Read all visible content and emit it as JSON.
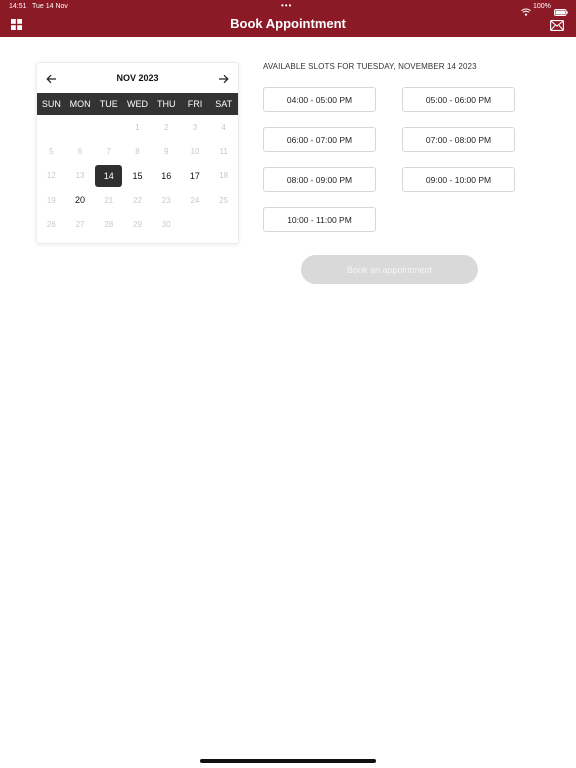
{
  "status_bar": {
    "time": "14:51",
    "date": "Tue 14 Nov",
    "dots": "•••",
    "battery": "100%"
  },
  "header": {
    "title": "Book Appointment",
    "menu_icon": "grid-icon",
    "mail_icon": "mail-icon",
    "background_color": "#8b1a26"
  },
  "calendar": {
    "month_label": "NOV 2023",
    "prev_icon": "arrow-left-icon",
    "next_icon": "arrow-right-icon",
    "weekdays": [
      "SUN",
      "MON",
      "TUE",
      "WED",
      "THU",
      "FRI",
      "SAT"
    ],
    "days": [
      {
        "label": "",
        "state": "blank"
      },
      {
        "label": "",
        "state": "blank"
      },
      {
        "label": "",
        "state": "blank"
      },
      {
        "label": "1",
        "state": "disabled"
      },
      {
        "label": "2",
        "state": "disabled"
      },
      {
        "label": "3",
        "state": "disabled"
      },
      {
        "label": "4",
        "state": "disabled"
      },
      {
        "label": "5",
        "state": "disabled"
      },
      {
        "label": "6",
        "state": "disabled"
      },
      {
        "label": "7",
        "state": "disabled"
      },
      {
        "label": "8",
        "state": "disabled"
      },
      {
        "label": "9",
        "state": "disabled"
      },
      {
        "label": "10",
        "state": "disabled"
      },
      {
        "label": "11",
        "state": "disabled"
      },
      {
        "label": "12",
        "state": "disabled"
      },
      {
        "label": "13",
        "state": "disabled"
      },
      {
        "label": "14",
        "state": "selected"
      },
      {
        "label": "15",
        "state": "active"
      },
      {
        "label": "16",
        "state": "active"
      },
      {
        "label": "17",
        "state": "active"
      },
      {
        "label": "18",
        "state": "disabled"
      },
      {
        "label": "19",
        "state": "disabled"
      },
      {
        "label": "20",
        "state": "active"
      },
      {
        "label": "21",
        "state": "disabled"
      },
      {
        "label": "22",
        "state": "disabled"
      },
      {
        "label": "23",
        "state": "disabled"
      },
      {
        "label": "24",
        "state": "disabled"
      },
      {
        "label": "25",
        "state": "disabled"
      },
      {
        "label": "26",
        "state": "disabled"
      },
      {
        "label": "27",
        "state": "disabled"
      },
      {
        "label": "28",
        "state": "disabled"
      },
      {
        "label": "29",
        "state": "disabled"
      },
      {
        "label": "30",
        "state": "disabled"
      }
    ]
  },
  "slots": {
    "heading": "AVAILABLE SLOTS FOR TUESDAY, NOVEMBER 14 2023",
    "items": [
      "04:00 - 05:00 PM",
      "05:00 - 06:00 PM",
      "06:00 - 07:00 PM",
      "07:00 - 08:00 PM",
      "08:00 - 09:00 PM",
      "09:00 - 10:00 PM",
      "10:00 - 11:00 PM"
    ]
  },
  "actions": {
    "book_label": "Book an appointment",
    "book_enabled": false
  }
}
